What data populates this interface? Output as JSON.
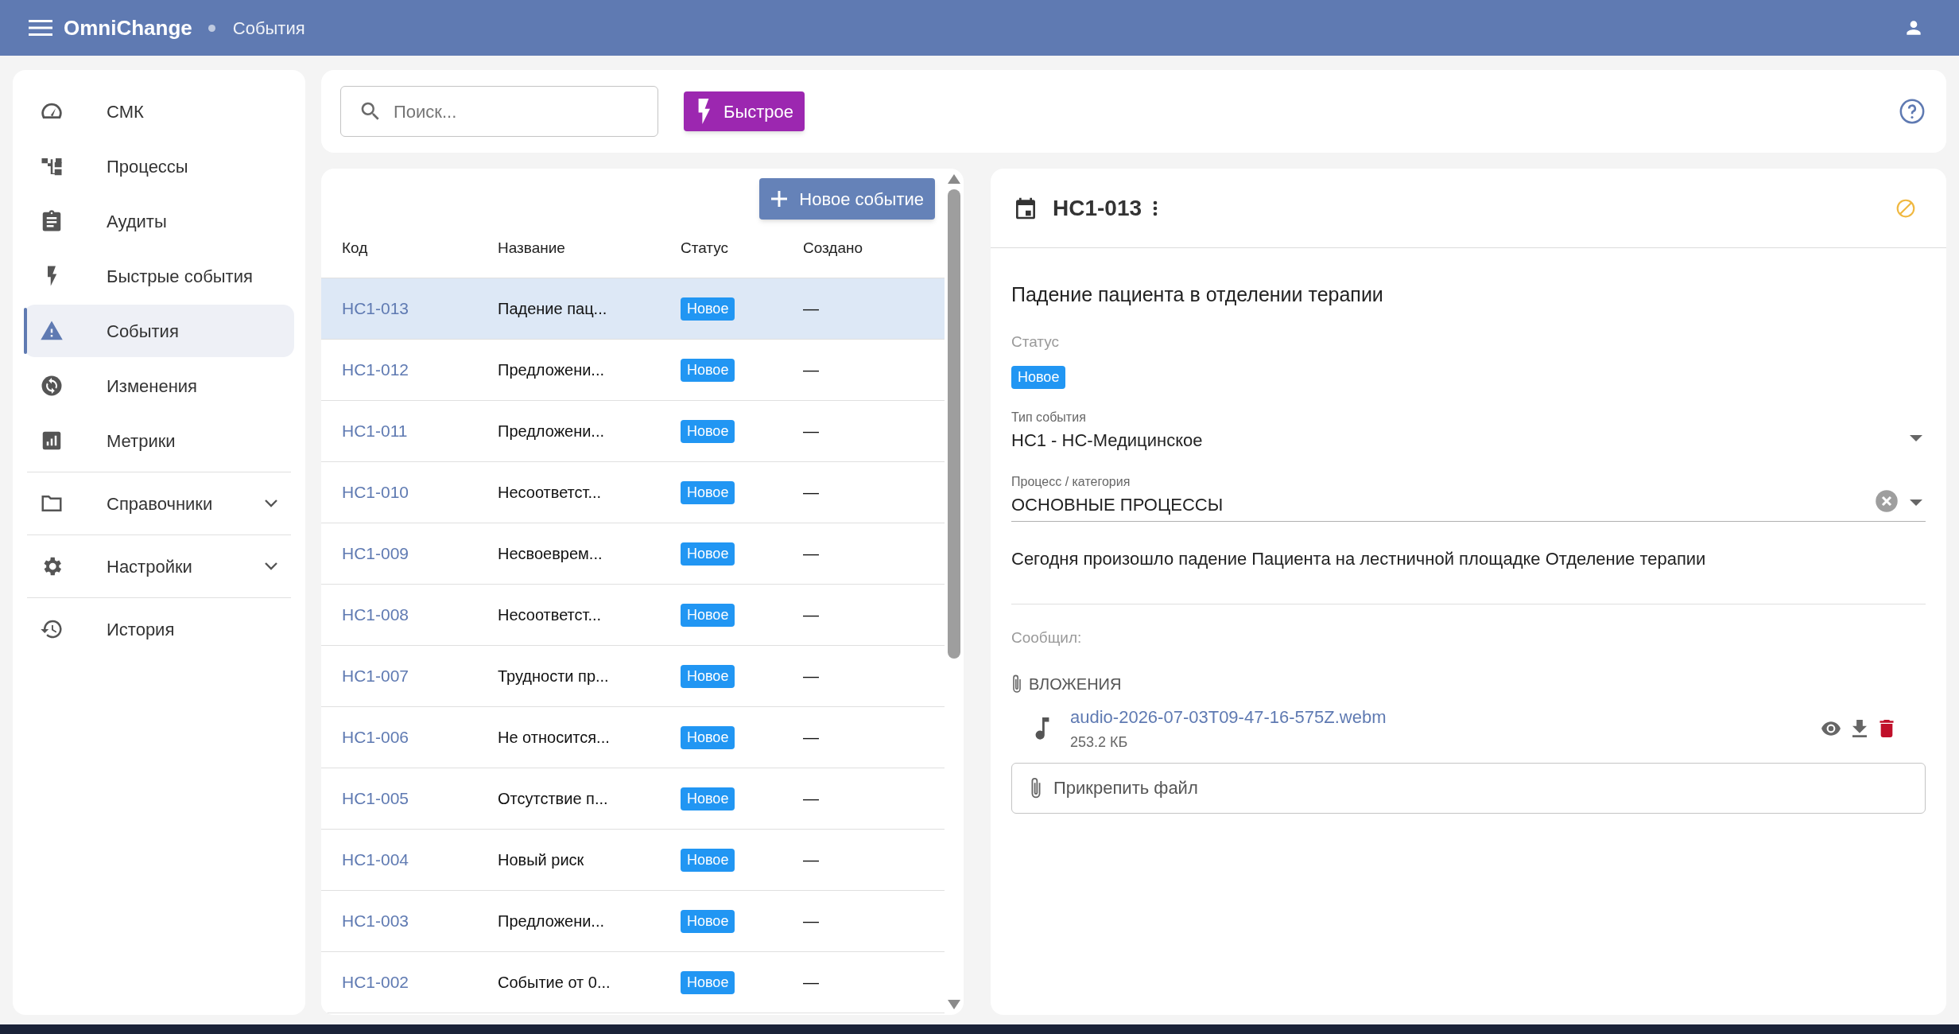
{
  "app_bar": {
    "brand": "OmniChange",
    "section": "События"
  },
  "sidebar": {
    "items": [
      {
        "label": "СМК",
        "selected": false
      },
      {
        "label": "Процессы",
        "selected": false
      },
      {
        "label": "Аудиты",
        "selected": false
      },
      {
        "label": "Быстрые события",
        "selected": false
      },
      {
        "label": "События",
        "selected": true
      },
      {
        "label": "Изменения",
        "selected": false
      },
      {
        "label": "Метрики",
        "selected": false
      },
      {
        "label": "Справочники",
        "selected": false,
        "expanded": false
      },
      {
        "label": "Настройки",
        "selected": false,
        "expanded": false
      },
      {
        "label": "История",
        "selected": false
      }
    ]
  },
  "toolbar": {
    "search": {
      "placeholder": "Поиск..."
    },
    "quick_button": "Быстрое"
  },
  "table": {
    "new_button": "Новое событие",
    "columns": [
      "Код",
      "Название",
      "Статус",
      "Создано"
    ],
    "rows": [
      {
        "code": "НС1-013",
        "name": "Падение пац...",
        "status": "Новое",
        "created": "—",
        "selected": true
      },
      {
        "code": "НС1-012",
        "name": "Предложени...",
        "status": "Новое",
        "created": "—",
        "selected": false
      },
      {
        "code": "НС1-011",
        "name": "Предложени...",
        "status": "Новое",
        "created": "—",
        "selected": false
      },
      {
        "code": "НС1-010",
        "name": "Несоответст...",
        "status": "Новое",
        "created": "—",
        "selected": false
      },
      {
        "code": "НС1-009",
        "name": "Несвоеврем...",
        "status": "Новое",
        "created": "—",
        "selected": false
      },
      {
        "code": "НС1-008",
        "name": "Несоответст...",
        "status": "Новое",
        "created": "—",
        "selected": false
      },
      {
        "code": "НС1-007",
        "name": "Трудности пр...",
        "status": "Новое",
        "created": "—",
        "selected": false
      },
      {
        "code": "НС1-006",
        "name": "Не относится...",
        "status": "Новое",
        "created": "—",
        "selected": false
      },
      {
        "code": "НС1-005",
        "name": "Отсутствие п...",
        "status": "Новое",
        "created": "—",
        "selected": false
      },
      {
        "code": "НС1-004",
        "name": "Новый риск",
        "status": "Новое",
        "created": "—",
        "selected": false
      },
      {
        "code": "НС1-003",
        "name": "Предложени...",
        "status": "Новое",
        "created": "—",
        "selected": false
      },
      {
        "code": "НС1-002",
        "name": "Событие от 0...",
        "status": "Новое",
        "created": "—",
        "selected": false
      }
    ]
  },
  "detail": {
    "code": "НС1-013",
    "title": "Падение пациента в отделении терапии",
    "status_label": "Статус",
    "status": "Новое",
    "fields": [
      {
        "label": "Тип события",
        "value": "НС1 - НС-Медицинское",
        "clearable": false
      },
      {
        "label": "Процесс / категория",
        "value": "ОСНОВНЫЕ ПРОЦЕССЫ",
        "clearable": true
      }
    ],
    "description": "Сегодня произошло падение Пациента на лестничной площадке Отделение терапии",
    "reporter_label": "Сообщил:",
    "attachments_label": "ВЛОЖЕНИЯ",
    "attachments": [
      {
        "name": "audio-2026-07-03T09-47-16-575Z.webm",
        "size": "253.2 КБ"
      }
    ],
    "attach_button": "Прикрепить файл"
  }
}
